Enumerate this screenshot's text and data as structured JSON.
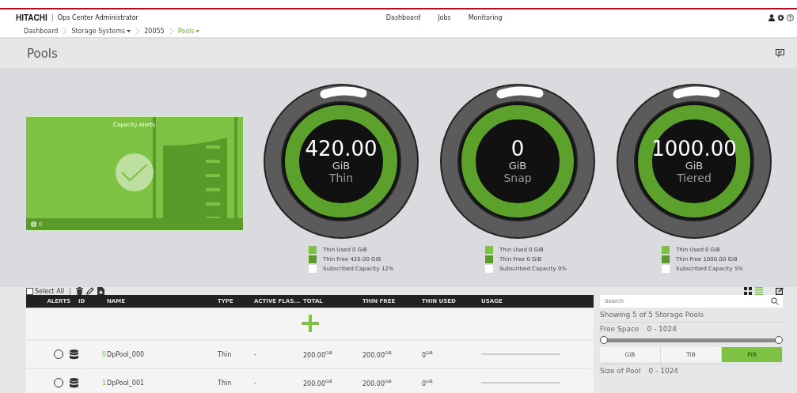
{
  "header": {
    "brand": "HITACHI",
    "product": "Ops Center Administrator",
    "nav": [
      {
        "label": "Dashboard"
      },
      {
        "label": "Jobs"
      },
      {
        "label": "Monitoring"
      }
    ]
  },
  "breadcrumb": [
    {
      "label": "Dashboard",
      "dropdown": false,
      "current": false
    },
    {
      "label": "Storage Systems",
      "dropdown": true,
      "current": false
    },
    {
      "label": "20055",
      "dropdown": false,
      "current": false
    },
    {
      "label": "Pools",
      "dropdown": true,
      "current": true
    }
  ],
  "page_title": "Pools",
  "alerts_card": {
    "title": "Capacity Alerts",
    "count": "0"
  },
  "gauges": [
    {
      "value": "420.00",
      "unit": "GiB",
      "label": "Thin",
      "legend": [
        {
          "kind": "used",
          "text": "Thin Used 0 GiB"
        },
        {
          "kind": "free",
          "text": "Thin Free 420.00 GiB"
        },
        {
          "kind": "subscribed",
          "text": "Subscribed Capacity 12%"
        }
      ]
    },
    {
      "value": "0",
      "unit": "GiB",
      "label": "Snap",
      "legend": [
        {
          "kind": "used",
          "text": "Thin Used 0 GiB"
        },
        {
          "kind": "free",
          "text": "Thin Free 0 GiB"
        },
        {
          "kind": "subscribed",
          "text": "Subscribed Capacity 0%"
        }
      ]
    },
    {
      "value": "1000.00",
      "unit": "GiB",
      "label": "Tiered",
      "legend": [
        {
          "kind": "used",
          "text": "Thin Used 0 GiB"
        },
        {
          "kind": "free",
          "text": "Thin Free 1000.00 GiB"
        },
        {
          "kind": "subscribed",
          "text": "Subscribed Capacity 5%"
        }
      ]
    }
  ],
  "toolbar": {
    "select_all": {
      "label": "Select All",
      "checked": false
    },
    "views": [
      {
        "kind": "tiles",
        "selected": false
      },
      {
        "kind": "list",
        "selected": true
      }
    ]
  },
  "table": {
    "columns": [
      "ALERTS",
      "ID",
      "NAME",
      "TYPE",
      "ACTIVE FLAS...",
      "TOTAL",
      "THIN FREE",
      "THIN USED",
      "USAGE"
    ],
    "rows": [
      {
        "selected": false,
        "id": "0",
        "name": "DpPool_000",
        "type": "Thin",
        "active_flash": "-",
        "total": "200.00$^{GiB}$",
        "thin_free": "200.00$^{GiB}$",
        "thin_used": "0$^{GiB}$"
      },
      {
        "selected": false,
        "id": "1",
        "name": "DpPool_001",
        "type": "Thin",
        "active_flash": "-",
        "total": "200.00$^{GiB}$",
        "thin_free": "200.00$^{GiB}$",
        "thin_used": "0$^{GiB}$"
      }
    ]
  },
  "filters": {
    "search": {
      "placeholder": "Search"
    },
    "summary": "Showing 5 of 5 Storage Pools",
    "free_space": {
      "label": "Free Space",
      "range": "0 - 1024",
      "level": 1
    },
    "units": [
      {
        "label": "GiB",
        "selected": false
      },
      {
        "label": "TiB",
        "selected": false
      },
      {
        "label": "PiB",
        "selected": true
      }
    ],
    "size_of_pool": {
      "label": "Size of Pool",
      "range": "0 - 1024"
    }
  }
}
